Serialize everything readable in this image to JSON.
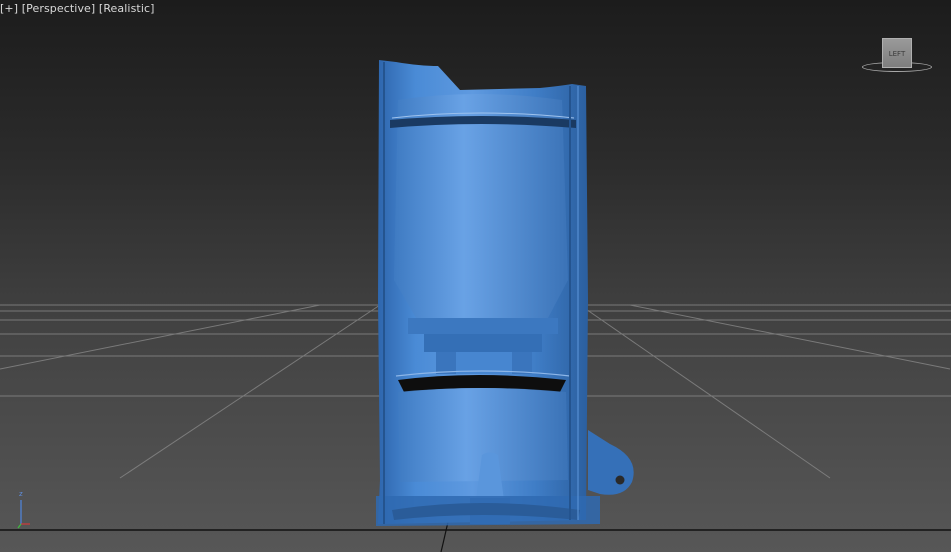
{
  "viewport": {
    "label": {
      "plus": "[+]",
      "view": "[Perspective]",
      "shading": "[Realistic]"
    },
    "viewcube": {
      "face": "LEFT"
    },
    "axis": {
      "z": "z"
    }
  },
  "colors": {
    "model": "#3a78c4",
    "model_dark": "#2a5f9e",
    "grid": "#9a9a9a",
    "background_top": "#1c1c1c",
    "background_bottom": "#575757"
  },
  "icons": [
    "viewcube-icon",
    "axis-tripod-icon"
  ]
}
